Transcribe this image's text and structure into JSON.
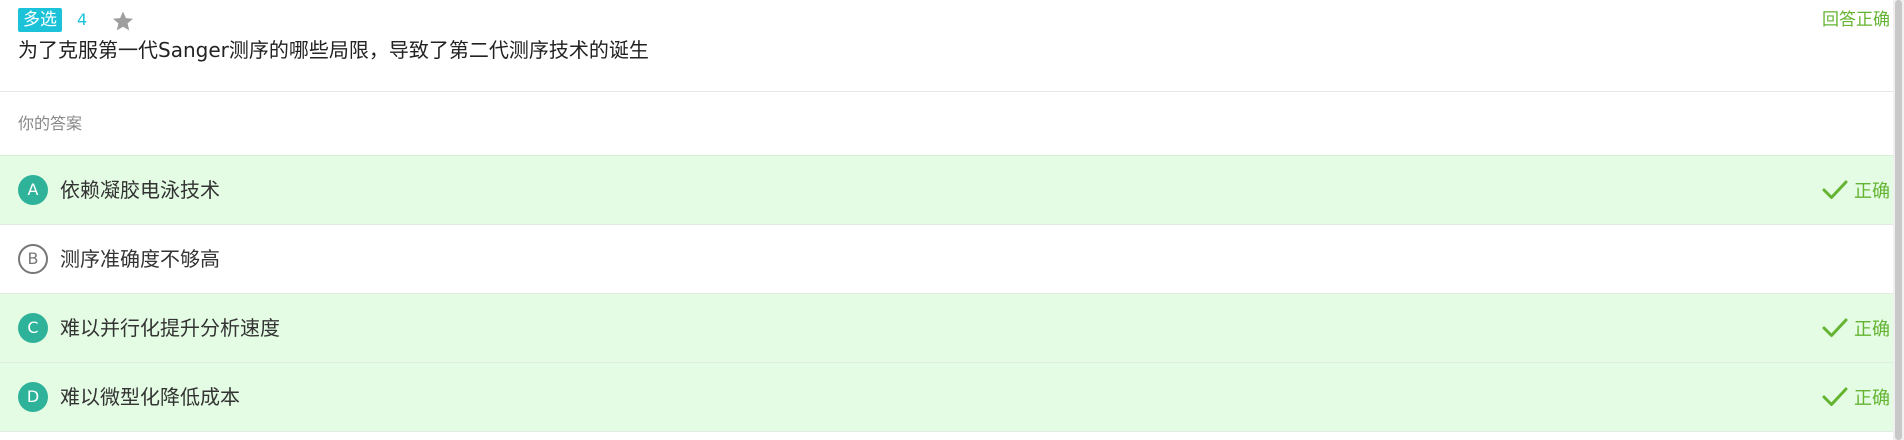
{
  "question": {
    "type_badge": "多选",
    "number": "4",
    "star_icon": "star-icon",
    "status": "回答正确",
    "stem": "为了克服第一代Sanger测序的哪些局限，导致了第二代测序技术的诞生"
  },
  "answer_section": {
    "label": "你的答案"
  },
  "options": [
    {
      "letter": "A",
      "text": "依赖凝胶电泳技术",
      "mark": "正确",
      "state": "correct"
    },
    {
      "letter": "B",
      "text": "测序准确度不够高",
      "mark": "",
      "state": "plain"
    },
    {
      "letter": "C",
      "text": "难以并行化提升分析速度",
      "mark": "正确",
      "state": "correct"
    },
    {
      "letter": "D",
      "text": "难以微型化降低成本",
      "mark": "正确",
      "state": "correct"
    }
  ],
  "colors": {
    "badge": "#1cc3d8",
    "correct_text": "#64b431",
    "correct_bg": "#e4fce4",
    "letter_bg": "#2eb39a"
  }
}
